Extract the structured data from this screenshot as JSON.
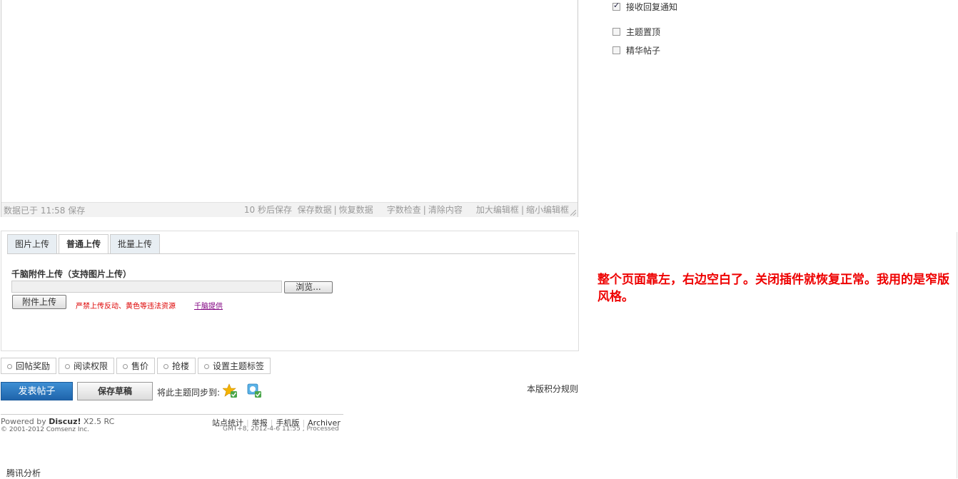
{
  "editor": {
    "status_left": "数据已于  11:58 保存",
    "autosave": "10 秒后保存",
    "save_data": "保存数据",
    "restore_data": "恢复数据",
    "word_check": "字数检查",
    "clear_content": "清除内容",
    "enlarge": "加大编辑框",
    "shrink": "缩小编辑框"
  },
  "options": {
    "notify": "接收回复通知",
    "sticky": "主题置顶",
    "digest": "精华帖子"
  },
  "upload": {
    "tabs": [
      "图片上传",
      "普通上传",
      "批量上传"
    ],
    "active_tab": "普通上传",
    "title": "千脑附件上传（支持图片上传）",
    "browse": "浏览...",
    "attach_button": "附件上传",
    "warning": "严禁上传反动、黄色等违法资源",
    "provider": "千脑提供"
  },
  "features": [
    "回帖奖励",
    "阅读权限",
    "售价",
    "抢楼",
    "设置主题标签"
  ],
  "post_row": {
    "post_button": "发表帖子",
    "draft_button": "保存草稿",
    "sync_label": "将此主题同步到:",
    "rules_link": "本版积分规则"
  },
  "footer": {
    "powered_prefix": "Powered by ",
    "brand": "Discuz!",
    "version": " X2.5 RC",
    "copyright": "© 2001-2012 Comsenz Inc.",
    "links": [
      "站点统计",
      "举报",
      "手机版",
      "Archiver"
    ],
    "meta": "GMT+8, 2012-4-6 11:55 , Processed"
  },
  "tencent": "腾讯分析",
  "annotation": "整个页面靠左，右边空白了。关闭插件就恢复正常。我用的是窄版风格。"
}
